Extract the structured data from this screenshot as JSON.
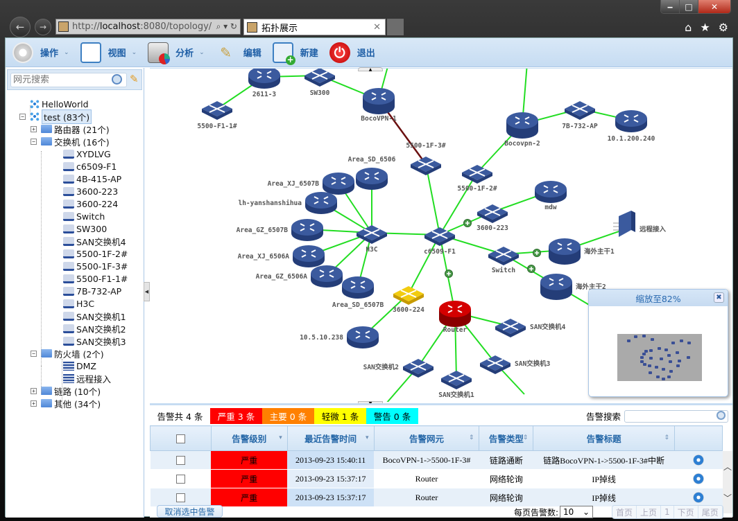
{
  "window": {
    "controls": {
      "minimize": "‒",
      "maximize": "□",
      "close": "✕"
    }
  },
  "browser": {
    "back_icon": "←",
    "forward_icon": "→",
    "address": {
      "prefix": "http://",
      "host": "localhost",
      "rest": ":8080/topology/"
    },
    "address_tools": "⌕ ▾ ↻",
    "tab": {
      "title": "拓扑展示",
      "close": "✕"
    },
    "tools": {
      "home": "⌂",
      "favorites": "★",
      "settings": "⚙"
    }
  },
  "toolbar": {
    "items": [
      {
        "label": "操作",
        "icon": "gear-icon",
        "dropdown": true
      },
      {
        "label": "视图",
        "icon": "view-icon",
        "dropdown": true
      },
      {
        "label": "分析",
        "icon": "analyze-icon",
        "dropdown": true
      },
      {
        "label": "编辑",
        "icon": "edit-icon",
        "dropdown": false
      },
      {
        "label": "新建",
        "icon": "new-icon",
        "dropdown": false
      },
      {
        "label": "退出",
        "icon": "exit-icon",
        "dropdown": false
      }
    ],
    "caret": "⌄"
  },
  "sidebar": {
    "search_placeholder": "网元搜索",
    "tree": [
      {
        "label": "HelloWorld",
        "type": "net",
        "level": 0
      },
      {
        "label": "test (83个)",
        "type": "net",
        "level": 0,
        "toggle": "−",
        "selected": true
      },
      {
        "label": "路由器 (21个)",
        "type": "folder",
        "level": 1,
        "toggle": "+"
      },
      {
        "label": "交换机 (16个)",
        "type": "folder",
        "level": 1,
        "toggle": "−"
      },
      {
        "label": "XYDLVG",
        "type": "switch",
        "level": 2
      },
      {
        "label": "c6509-F1",
        "type": "switch",
        "level": 2
      },
      {
        "label": "4B-415-AP",
        "type": "switch",
        "level": 2
      },
      {
        "label": "3600-223",
        "type": "switch",
        "level": 2
      },
      {
        "label": "3600-224",
        "type": "switch",
        "level": 2
      },
      {
        "label": "Switch",
        "type": "switch",
        "level": 2
      },
      {
        "label": "SW300",
        "type": "switch",
        "level": 2
      },
      {
        "label": "SAN交换机4",
        "type": "switch",
        "level": 2
      },
      {
        "label": "5500-1F-2#",
        "type": "switch",
        "level": 2
      },
      {
        "label": "5500-1F-3#",
        "type": "switch",
        "level": 2
      },
      {
        "label": "5500-F1-1#",
        "type": "switch",
        "level": 2
      },
      {
        "label": "7B-732-AP",
        "type": "switch",
        "level": 2
      },
      {
        "label": "H3C",
        "type": "switch",
        "level": 2
      },
      {
        "label": "SAN交换机1",
        "type": "switch",
        "level": 2
      },
      {
        "label": "SAN交换机2",
        "type": "switch",
        "level": 2
      },
      {
        "label": "SAN交换机3",
        "type": "switch",
        "level": 2
      },
      {
        "label": "防火墙 (2个)",
        "type": "folder",
        "level": 1,
        "toggle": "−"
      },
      {
        "label": "DMZ",
        "type": "firewall",
        "level": 2
      },
      {
        "label": "远程接入",
        "type": "firewall",
        "level": 2
      },
      {
        "label": "链路 (10个)",
        "type": "folder",
        "level": 1,
        "toggle": "+"
      },
      {
        "label": "其他 (34个)",
        "type": "folder",
        "level": 1,
        "toggle": "+"
      }
    ]
  },
  "topology": {
    "nodes": [
      {
        "id": "2611-3",
        "label": "2611-3",
        "type": "router"
      },
      {
        "id": "SW300",
        "label": "SW300",
        "type": "switch"
      },
      {
        "id": "5500-F1-1#",
        "label": "5500-F1-1#",
        "type": "switch"
      },
      {
        "id": "BocoVPN-1",
        "label": "BocoVPN-1",
        "type": "core"
      },
      {
        "id": "5500-1F-3#",
        "label": "5500-1F-3#",
        "type": "switch"
      },
      {
        "id": "Bocovpn-2",
        "label": "Bocovpn-2",
        "type": "core"
      },
      {
        "id": "7B-732-AP",
        "label": "7B-732-AP",
        "type": "switch"
      },
      {
        "id": "10.1.200.240",
        "label": "10.1.200.240",
        "type": "router"
      },
      {
        "id": "5500-1F-2#",
        "label": "5500-1F-2#",
        "type": "switch"
      },
      {
        "id": "mdw",
        "label": "mdw",
        "type": "router"
      },
      {
        "id": "3600-223",
        "label": "3600-223",
        "type": "switch"
      },
      {
        "id": "Area_SD_6506",
        "label": "Area_SD_6506",
        "type": "router"
      },
      {
        "id": "Area_XJ_6507B",
        "label": "Area_XJ_6507B",
        "type": "router"
      },
      {
        "id": "lh-yanshanshihua",
        "label": "lh-yanshanshihua",
        "type": "router"
      },
      {
        "id": "Area_GZ_6507B",
        "label": "Area_GZ_6507B",
        "type": "router"
      },
      {
        "id": "Area_XJ_6506A",
        "label": "Area_XJ_6506A",
        "type": "router"
      },
      {
        "id": "Area_GZ_6506A",
        "label": "Area_GZ_6506A",
        "type": "router"
      },
      {
        "id": "Area_SD_6507B",
        "label": "Area_SD_6507B",
        "type": "router"
      },
      {
        "id": "H3C",
        "label": "H3C",
        "type": "switch"
      },
      {
        "id": "c6509-F1",
        "label": "c6509-F1",
        "type": "switch"
      },
      {
        "id": "Switch",
        "label": "Switch",
        "type": "switch"
      },
      {
        "id": "海外主干1",
        "label": "海外主干1",
        "type": "core"
      },
      {
        "id": "海外主干2",
        "label": "海外主干2",
        "type": "core"
      },
      {
        "id": "远程接入",
        "label": "远程接入",
        "type": "firewall"
      },
      {
        "id": "3600-224",
        "label": "3600-224",
        "type": "switch-warn"
      },
      {
        "id": "Router",
        "label": "Router",
        "type": "core-alarm"
      },
      {
        "id": "10.5.10.238",
        "label": "10.5.10.238",
        "type": "router"
      },
      {
        "id": "SAN交换机4",
        "label": "SAN交换机4",
        "type": "switch"
      },
      {
        "id": "SAN交换机2",
        "label": "SAN交换机2",
        "type": "switch"
      },
      {
        "id": "SAN交换机1",
        "label": "SAN交换机1",
        "type": "switch"
      },
      {
        "id": "SAN交换机3",
        "label": "SAN交换机3",
        "type": "switch"
      }
    ],
    "links": [
      [
        "2611-3",
        "SW300",
        "normal"
      ],
      [
        "2611-3",
        "5500-F1-1#",
        "normal"
      ],
      [
        "SW300",
        "BocoVPN-1",
        "normal"
      ],
      [
        "BocoVPN-1",
        "5500-1F-3#",
        "down"
      ],
      [
        "5500-1F-3#",
        "c6509-F1",
        "normal"
      ],
      [
        "Bocovpn-2",
        "7B-732-AP",
        "normal"
      ],
      [
        "7B-732-AP",
        "10.1.200.240",
        "normal"
      ],
      [
        "Bocovpn-2",
        "5500-1F-2#",
        "normal"
      ],
      [
        "5500-1F-2#",
        "c6509-F1",
        "normal"
      ],
      [
        "3600-223",
        "mdw",
        "normal"
      ],
      [
        "3600-223",
        "c6509-F1",
        "normal"
      ],
      [
        "H3C",
        "Area_SD_6506",
        "normal"
      ],
      [
        "H3C",
        "Area_XJ_6507B",
        "normal"
      ],
      [
        "H3C",
        "lh-yanshanshihua",
        "normal"
      ],
      [
        "H3C",
        "Area_GZ_6507B",
        "normal"
      ],
      [
        "H3C",
        "Area_XJ_6506A",
        "normal"
      ],
      [
        "H3C",
        "Area_GZ_6506A",
        "normal"
      ],
      [
        "H3C",
        "Area_SD_6507B",
        "normal"
      ],
      [
        "H3C",
        "c6509-F1",
        "normal"
      ],
      [
        "c6509-F1",
        "Switch",
        "normal"
      ],
      [
        "Switch",
        "海外主干1",
        "normal"
      ],
      [
        "Switch",
        "海外主干2",
        "normal"
      ],
      [
        "海外主干1",
        "远程接入",
        "normal"
      ],
      [
        "c6509-F1",
        "3600-224",
        "normal"
      ],
      [
        "c6509-F1",
        "Router",
        "normal"
      ],
      [
        "3600-224",
        "10.5.10.238",
        "normal"
      ],
      [
        "Router",
        "SAN交换机4",
        "normal"
      ],
      [
        "Router",
        "SAN交换机2",
        "normal"
      ],
      [
        "Router",
        "SAN交换机1",
        "normal"
      ],
      [
        "Router",
        "SAN交换机3",
        "normal"
      ]
    ],
    "link_colors": {
      "normal": "#22dd22",
      "down": "#6b1010"
    },
    "node_colors": {
      "device": "#3b5a9e",
      "alarm": "#d40000",
      "warn": "#f2cc10"
    }
  },
  "zoom_panel": {
    "title": "缩放至82%",
    "close": "✖"
  },
  "alarms": {
    "summary": [
      {
        "label": "告警共 4 条",
        "color": "#ffffff"
      },
      {
        "label": "严重 3 条",
        "color": "#ff0000"
      },
      {
        "label": "主要 0 条",
        "color": "#ff8000"
      },
      {
        "label": "轻微 1 条",
        "color": "#ffff00"
      },
      {
        "label": "警告 0 条",
        "color": "#00ffff"
      }
    ],
    "search_label": "告警搜索",
    "search_value": "",
    "columns": [
      "",
      "告警级别",
      "最近告警时间",
      "告警网元",
      "告警类型",
      "告警标题",
      ""
    ],
    "rows": [
      {
        "level": "严重",
        "time": "2013-09-23 15:40:11",
        "element": "BocoVPN-1->5500-1F-3#",
        "type": "链路通断",
        "title": "链路BocoVPN-1->5500-1F-3#中断"
      },
      {
        "level": "严重",
        "time": "2013-09-23 15:37:17",
        "element": "Router",
        "type": "网络轮询",
        "title": "IP掉线"
      },
      {
        "level": "严重",
        "time": "2013-09-23 15:37:17",
        "element": "Router",
        "type": "网络轮询",
        "title": "IP掉线"
      }
    ],
    "cancel_label": "取消选中告警",
    "per_page_label": "每页告警数:",
    "per_page_value": "10",
    "pager": [
      "首页",
      "上页",
      "1",
      "下页",
      "尾页"
    ]
  }
}
